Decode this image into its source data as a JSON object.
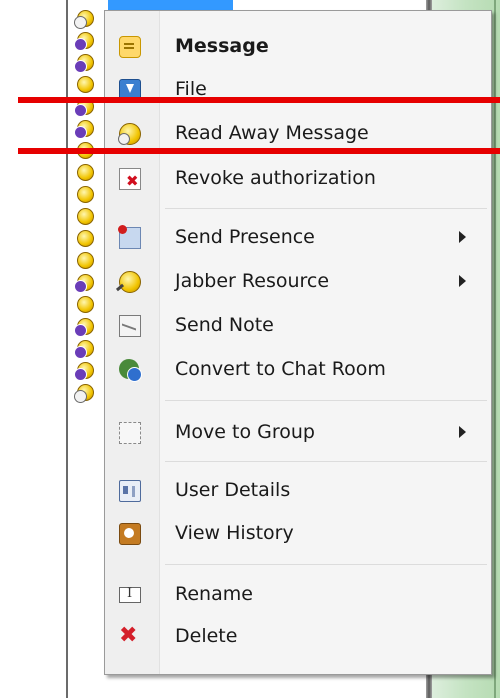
{
  "menu": {
    "items": [
      {
        "label": "Message",
        "icon": "message-icon",
        "bold": true
      },
      {
        "label": "File",
        "icon": "file-transfer-icon"
      },
      {
        "label": "Read Away Message",
        "icon": "away-status-icon"
      },
      {
        "label": "Revoke authorization",
        "icon": "revoke-authorization-icon"
      },
      {
        "label": "Send Presence",
        "icon": "send-presence-icon",
        "submenu": true
      },
      {
        "label": "Jabber Resource",
        "icon": "jabber-resource-icon",
        "submenu": true
      },
      {
        "label": "Send Note",
        "icon": "note-envelope-icon"
      },
      {
        "label": "Convert to Chat Room",
        "icon": "chat-room-icon"
      },
      {
        "label": "Move to Group",
        "icon": "group-icon",
        "submenu": true
      },
      {
        "label": "User Details",
        "icon": "user-details-icon"
      },
      {
        "label": "View History",
        "icon": "history-icon"
      },
      {
        "label": "Rename",
        "icon": "rename-icon"
      },
      {
        "label": "Delete",
        "icon": "delete-icon"
      }
    ]
  },
  "contacts": {
    "status_icons": [
      "away",
      "purple",
      "purple",
      "none",
      "purple",
      "purple",
      "none",
      "none",
      "none",
      "none",
      "none",
      "none",
      "purple",
      "none",
      "purple",
      "purple",
      "purple",
      "away"
    ]
  },
  "colors": {
    "strike_line": "#e60000",
    "selection": "#3399ff",
    "menu_background": "#f5f5f5"
  }
}
